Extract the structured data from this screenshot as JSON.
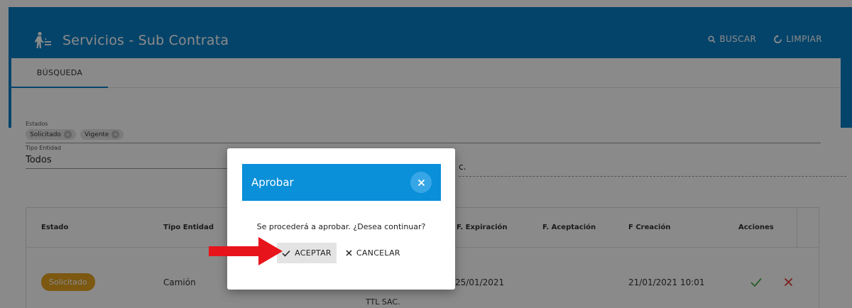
{
  "header": {
    "title": "Servicios - Sub Contrata",
    "search_label": "BUSCAR",
    "clear_label": "LIMPIAR"
  },
  "tabs": [
    {
      "label": "BÚSQUEDA"
    }
  ],
  "filters": {
    "estados_label": "Estados",
    "estados_chips": [
      "Solicitado",
      "Vigente"
    ],
    "tipo_entidad_label": "Tipo Entidad",
    "tipo_entidad_value": "Todos",
    "right_value_partial": "c."
  },
  "table": {
    "columns": [
      "Estado",
      "Tipo Entidad",
      "F. Expiración",
      "F. Aceptación",
      "F Creación",
      "Acciones"
    ],
    "rows": [
      {
        "estado": "Solicitado",
        "tipo_entidad": "Camión",
        "partial": "TTL SAC.",
        "f_expiracion": "25/01/2021",
        "f_creacion": "21/01/2021 10:01"
      }
    ]
  },
  "dialog": {
    "title": "Aprobar",
    "message": "Se procederá a aprobar. ¿Desea continuar?",
    "accept_label": "ACEPTAR",
    "cancel_label": "CANCELAR"
  },
  "colors": {
    "brand": "#0a7fc4",
    "dialog_header": "#0a8fd9",
    "status_solicitado": "#e6a320",
    "approve_green": "#4caf50",
    "reject_red": "#e53935",
    "annotation_arrow": "#e8141b"
  }
}
